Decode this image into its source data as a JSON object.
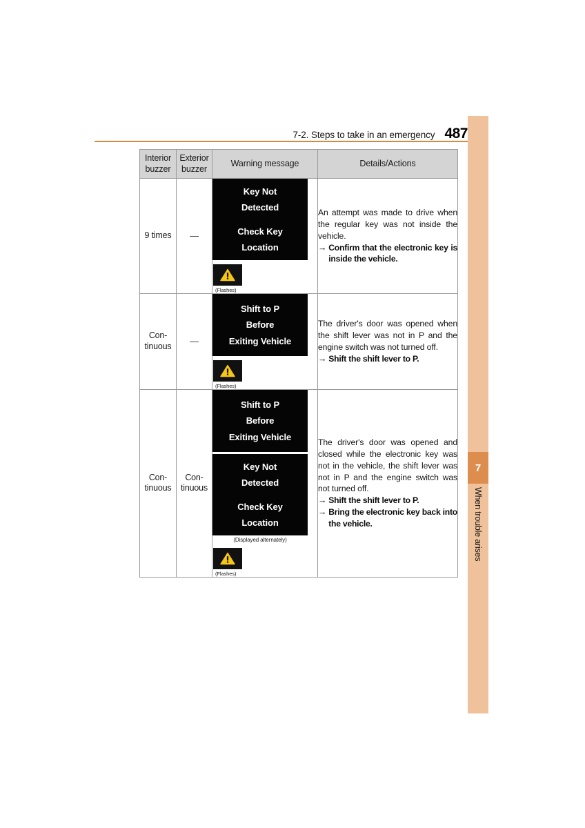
{
  "header": {
    "section": "7-2. Steps to take in an emergency",
    "page_number": "487",
    "rule_color": "#d9893f"
  },
  "side_tab": {
    "chapter_number": "7",
    "chapter_label": "When trouble arises",
    "band_color": "#efc29b",
    "box_color": "#dd8e4e"
  },
  "table": {
    "headers": {
      "interior": "Interior\nbuzzer",
      "interior_line1": "Interior",
      "interior_line2": "buzzer",
      "exterior_line1": "Exterior",
      "exterior_line2": "buzzer",
      "warning_message": "Warning message",
      "details_actions": "Details/Actions"
    },
    "rows": [
      {
        "interior_buzzer": "9 times",
        "exterior_buzzer": "—",
        "panels": [
          {
            "lines": [
              "Key Not",
              "Detected",
              "",
              "Check Key",
              "Location"
            ]
          }
        ],
        "panel_caption": "",
        "flash_caption": "(Flashes)",
        "details_paragraph": "An attempt was made to drive when the regular key was not inside the vehicle.",
        "actions": [
          "Confirm that the electronic key is inside the vehicle."
        ]
      },
      {
        "interior_buzzer": "Con-\ntinuous",
        "interior_line1": "Con-",
        "interior_line2": "tinuous",
        "exterior_buzzer": "—",
        "panels": [
          {
            "lines": [
              "Shift to P",
              "Before",
              "Exiting Vehicle"
            ]
          }
        ],
        "panel_caption": "",
        "flash_caption": "(Flashes)",
        "details_paragraph": "The driver's door was opened when the shift lever was not in P and the engine switch was not turned off.",
        "actions": [
          "Shift the shift lever to P."
        ]
      },
      {
        "interior_line1": "Con-",
        "interior_line2": "tinuous",
        "exterior_line1": "Con-",
        "exterior_line2": "tinuous",
        "panels": [
          {
            "lines": [
              "Shift to P",
              "Before",
              "Exiting Vehicle"
            ]
          },
          {
            "lines": [
              "Key Not",
              "Detected",
              "",
              "Check Key",
              "Location"
            ]
          }
        ],
        "panel_caption": "(Displayed alternately)",
        "flash_caption": "(Flashes)",
        "details_paragraph": "The driver's door was opened and closed while the electronic key was not in the vehicle, the shift lever was not in P and the engine switch was not turned off.",
        "actions": [
          "Shift the shift lever to P.",
          "Bring the electronic key back into the vehicle."
        ]
      }
    ]
  },
  "icons": {
    "warning_triangle": "warning-triangle-icon",
    "arrow": "→"
  },
  "colors": {
    "panel_background": "#050505",
    "warning_yellow": "#f5c518",
    "header_fill": "#d4d4d4"
  }
}
